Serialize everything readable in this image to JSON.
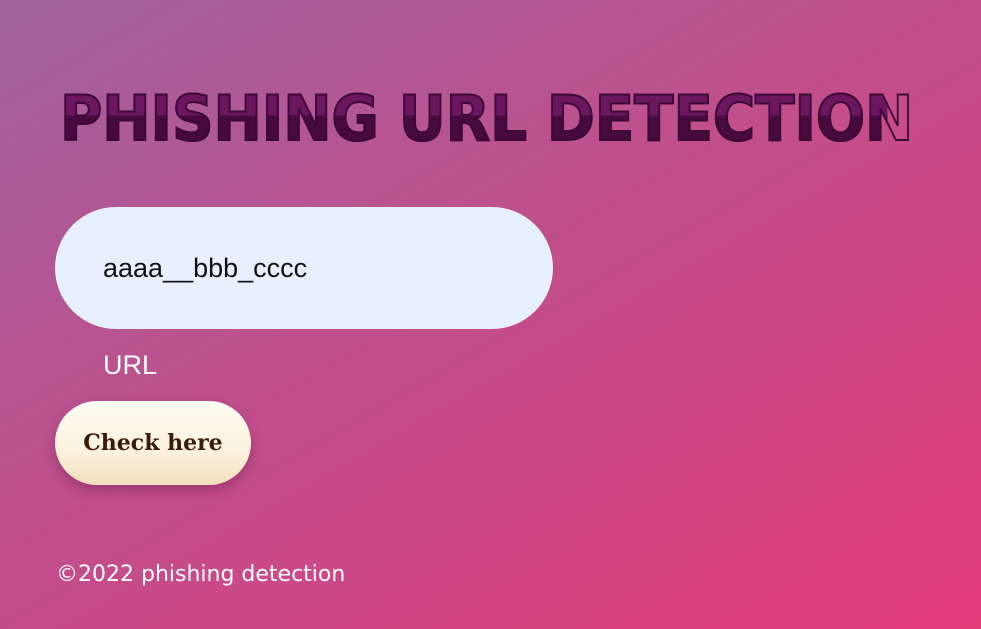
{
  "header": {
    "title": "PHISHING URL DETECTION"
  },
  "form": {
    "url_value": "aaaa__bbb_cccc",
    "url_label": "URL",
    "submit_label": "Check here"
  },
  "footer": {
    "copyright": "©2022 phishing detection"
  },
  "colors": {
    "background_start": "#a0629d",
    "background_end": "#e43b79",
    "title": "#4a0c41",
    "input_background": "#e8f0fe",
    "button_background": "#fbf1dd",
    "button_text": "#3b1a08"
  }
}
